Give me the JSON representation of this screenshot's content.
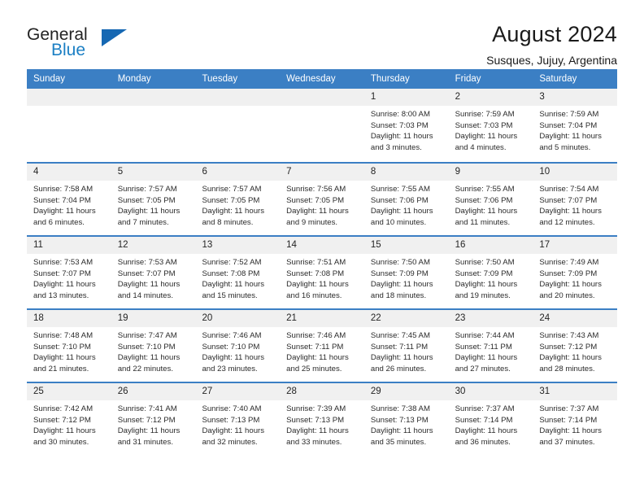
{
  "brand": {
    "line1": "General",
    "line2": "Blue",
    "triangle_color": "#1668b3"
  },
  "header": {
    "title": "August 2024",
    "subtitle": "Susques, Jujuy, Argentina"
  },
  "theme": {
    "header_blue": "#3b7fc4",
    "day_strip_gray": "#f0f0f0",
    "text": "#2b2b2b"
  },
  "weekdays": [
    "Sunday",
    "Monday",
    "Tuesday",
    "Wednesday",
    "Thursday",
    "Friday",
    "Saturday"
  ],
  "weeks": [
    [
      {
        "day": "",
        "sunrise": "",
        "sunset": "",
        "daylight_line1": "",
        "daylight_line2": ""
      },
      {
        "day": "",
        "sunrise": "",
        "sunset": "",
        "daylight_line1": "",
        "daylight_line2": ""
      },
      {
        "day": "",
        "sunrise": "",
        "sunset": "",
        "daylight_line1": "",
        "daylight_line2": ""
      },
      {
        "day": "",
        "sunrise": "",
        "sunset": "",
        "daylight_line1": "",
        "daylight_line2": ""
      },
      {
        "day": "1",
        "sunrise": "Sunrise: 8:00 AM",
        "sunset": "Sunset: 7:03 PM",
        "daylight_line1": "Daylight: 11 hours",
        "daylight_line2": "and 3 minutes."
      },
      {
        "day": "2",
        "sunrise": "Sunrise: 7:59 AM",
        "sunset": "Sunset: 7:03 PM",
        "daylight_line1": "Daylight: 11 hours",
        "daylight_line2": "and 4 minutes."
      },
      {
        "day": "3",
        "sunrise": "Sunrise: 7:59 AM",
        "sunset": "Sunset: 7:04 PM",
        "daylight_line1": "Daylight: 11 hours",
        "daylight_line2": "and 5 minutes."
      }
    ],
    [
      {
        "day": "4",
        "sunrise": "Sunrise: 7:58 AM",
        "sunset": "Sunset: 7:04 PM",
        "daylight_line1": "Daylight: 11 hours",
        "daylight_line2": "and 6 minutes."
      },
      {
        "day": "5",
        "sunrise": "Sunrise: 7:57 AM",
        "sunset": "Sunset: 7:05 PM",
        "daylight_line1": "Daylight: 11 hours",
        "daylight_line2": "and 7 minutes."
      },
      {
        "day": "6",
        "sunrise": "Sunrise: 7:57 AM",
        "sunset": "Sunset: 7:05 PM",
        "daylight_line1": "Daylight: 11 hours",
        "daylight_line2": "and 8 minutes."
      },
      {
        "day": "7",
        "sunrise": "Sunrise: 7:56 AM",
        "sunset": "Sunset: 7:05 PM",
        "daylight_line1": "Daylight: 11 hours",
        "daylight_line2": "and 9 minutes."
      },
      {
        "day": "8",
        "sunrise": "Sunrise: 7:55 AM",
        "sunset": "Sunset: 7:06 PM",
        "daylight_line1": "Daylight: 11 hours",
        "daylight_line2": "and 10 minutes."
      },
      {
        "day": "9",
        "sunrise": "Sunrise: 7:55 AM",
        "sunset": "Sunset: 7:06 PM",
        "daylight_line1": "Daylight: 11 hours",
        "daylight_line2": "and 11 minutes."
      },
      {
        "day": "10",
        "sunrise": "Sunrise: 7:54 AM",
        "sunset": "Sunset: 7:07 PM",
        "daylight_line1": "Daylight: 11 hours",
        "daylight_line2": "and 12 minutes."
      }
    ],
    [
      {
        "day": "11",
        "sunrise": "Sunrise: 7:53 AM",
        "sunset": "Sunset: 7:07 PM",
        "daylight_line1": "Daylight: 11 hours",
        "daylight_line2": "and 13 minutes."
      },
      {
        "day": "12",
        "sunrise": "Sunrise: 7:53 AM",
        "sunset": "Sunset: 7:07 PM",
        "daylight_line1": "Daylight: 11 hours",
        "daylight_line2": "and 14 minutes."
      },
      {
        "day": "13",
        "sunrise": "Sunrise: 7:52 AM",
        "sunset": "Sunset: 7:08 PM",
        "daylight_line1": "Daylight: 11 hours",
        "daylight_line2": "and 15 minutes."
      },
      {
        "day": "14",
        "sunrise": "Sunrise: 7:51 AM",
        "sunset": "Sunset: 7:08 PM",
        "daylight_line1": "Daylight: 11 hours",
        "daylight_line2": "and 16 minutes."
      },
      {
        "day": "15",
        "sunrise": "Sunrise: 7:50 AM",
        "sunset": "Sunset: 7:09 PM",
        "daylight_line1": "Daylight: 11 hours",
        "daylight_line2": "and 18 minutes."
      },
      {
        "day": "16",
        "sunrise": "Sunrise: 7:50 AM",
        "sunset": "Sunset: 7:09 PM",
        "daylight_line1": "Daylight: 11 hours",
        "daylight_line2": "and 19 minutes."
      },
      {
        "day": "17",
        "sunrise": "Sunrise: 7:49 AM",
        "sunset": "Sunset: 7:09 PM",
        "daylight_line1": "Daylight: 11 hours",
        "daylight_line2": "and 20 minutes."
      }
    ],
    [
      {
        "day": "18",
        "sunrise": "Sunrise: 7:48 AM",
        "sunset": "Sunset: 7:10 PM",
        "daylight_line1": "Daylight: 11 hours",
        "daylight_line2": "and 21 minutes."
      },
      {
        "day": "19",
        "sunrise": "Sunrise: 7:47 AM",
        "sunset": "Sunset: 7:10 PM",
        "daylight_line1": "Daylight: 11 hours",
        "daylight_line2": "and 22 minutes."
      },
      {
        "day": "20",
        "sunrise": "Sunrise: 7:46 AM",
        "sunset": "Sunset: 7:10 PM",
        "daylight_line1": "Daylight: 11 hours",
        "daylight_line2": "and 23 minutes."
      },
      {
        "day": "21",
        "sunrise": "Sunrise: 7:46 AM",
        "sunset": "Sunset: 7:11 PM",
        "daylight_line1": "Daylight: 11 hours",
        "daylight_line2": "and 25 minutes."
      },
      {
        "day": "22",
        "sunrise": "Sunrise: 7:45 AM",
        "sunset": "Sunset: 7:11 PM",
        "daylight_line1": "Daylight: 11 hours",
        "daylight_line2": "and 26 minutes."
      },
      {
        "day": "23",
        "sunrise": "Sunrise: 7:44 AM",
        "sunset": "Sunset: 7:11 PM",
        "daylight_line1": "Daylight: 11 hours",
        "daylight_line2": "and 27 minutes."
      },
      {
        "day": "24",
        "sunrise": "Sunrise: 7:43 AM",
        "sunset": "Sunset: 7:12 PM",
        "daylight_line1": "Daylight: 11 hours",
        "daylight_line2": "and 28 minutes."
      }
    ],
    [
      {
        "day": "25",
        "sunrise": "Sunrise: 7:42 AM",
        "sunset": "Sunset: 7:12 PM",
        "daylight_line1": "Daylight: 11 hours",
        "daylight_line2": "and 30 minutes."
      },
      {
        "day": "26",
        "sunrise": "Sunrise: 7:41 AM",
        "sunset": "Sunset: 7:12 PM",
        "daylight_line1": "Daylight: 11 hours",
        "daylight_line2": "and 31 minutes."
      },
      {
        "day": "27",
        "sunrise": "Sunrise: 7:40 AM",
        "sunset": "Sunset: 7:13 PM",
        "daylight_line1": "Daylight: 11 hours",
        "daylight_line2": "and 32 minutes."
      },
      {
        "day": "28",
        "sunrise": "Sunrise: 7:39 AM",
        "sunset": "Sunset: 7:13 PM",
        "daylight_line1": "Daylight: 11 hours",
        "daylight_line2": "and 33 minutes."
      },
      {
        "day": "29",
        "sunrise": "Sunrise: 7:38 AM",
        "sunset": "Sunset: 7:13 PM",
        "daylight_line1": "Daylight: 11 hours",
        "daylight_line2": "and 35 minutes."
      },
      {
        "day": "30",
        "sunrise": "Sunrise: 7:37 AM",
        "sunset": "Sunset: 7:14 PM",
        "daylight_line1": "Daylight: 11 hours",
        "daylight_line2": "and 36 minutes."
      },
      {
        "day": "31",
        "sunrise": "Sunrise: 7:37 AM",
        "sunset": "Sunset: 7:14 PM",
        "daylight_line1": "Daylight: 11 hours",
        "daylight_line2": "and 37 minutes."
      }
    ]
  ]
}
